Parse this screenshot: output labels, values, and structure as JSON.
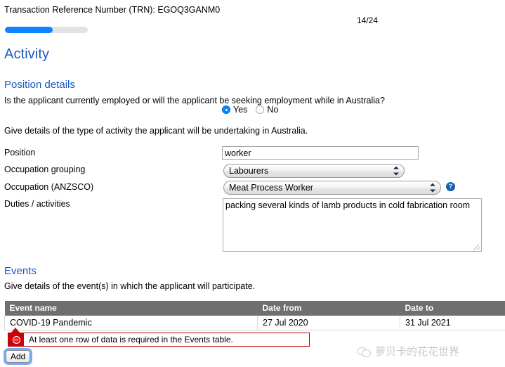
{
  "header": {
    "trn_text": "Transaction Reference Number (TRN): EGOQ3GANM0",
    "page_counter": "14/24",
    "progress_percent": 58
  },
  "activity": {
    "title": "Activity"
  },
  "position_details": {
    "title": "Position details",
    "question": "Is the applicant currently employed or will the applicant be seeking employment while in Australia?",
    "radio_options": [
      {
        "label": "Yes",
        "checked": true
      },
      {
        "label": "No",
        "checked": false
      }
    ],
    "intro": "Give details of the type of activity the applicant will be undertaking in Australia.",
    "fields": {
      "position": {
        "label": "Position",
        "value": "worker",
        "placeholder": ""
      },
      "occupation_grouping": {
        "label": "Occupation grouping",
        "value": "Labourers"
      },
      "occupation_anzsco": {
        "label": "Occupation (ANZSCO)",
        "value": "Meat Process Worker",
        "help_glyph": "?"
      },
      "duties": {
        "label": "Duties / activities",
        "value": "packing several kinds of lamb products in cold fabrication room",
        "placeholder": ""
      }
    }
  },
  "events": {
    "title": "Events",
    "intro": "Give details of the event(s) in which the applicant will participate.",
    "table": {
      "columns": [
        "Event name",
        "Date from",
        "Date to"
      ],
      "rows": [
        [
          "COVID-19 Pandemic",
          "27 Jul 2020",
          "31 Jul 2021"
        ]
      ]
    },
    "error_message": "At least one row of data is required in the Events table.",
    "add_label": "Add"
  },
  "watermark": {
    "text": "萝贝卡的花花世界"
  },
  "colors": {
    "heading_blue": "#1a57c2",
    "progress_blue": "#0a84ff",
    "table_header_grey": "#6f6f6f",
    "error_red": "#c8040b",
    "help_blue": "#1360b0"
  }
}
